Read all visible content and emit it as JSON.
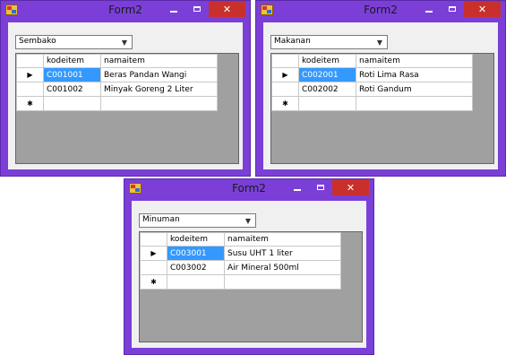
{
  "windows": [
    {
      "title": "Form2",
      "combo_value": "Sembako",
      "headers": [
        "kodeitem",
        "namaitem"
      ],
      "rows": [
        {
          "kode": "C001001",
          "nama": "Beras Pandan Wangi"
        },
        {
          "kode": "C001002",
          "nama": "Minyak Goreng 2 Liter"
        }
      ]
    },
    {
      "title": "Form2",
      "combo_value": "Makanan",
      "headers": [
        "kodeitem",
        "namaitem"
      ],
      "rows": [
        {
          "kode": "C002001",
          "nama": "Roti Lima Rasa"
        },
        {
          "kode": "C002002",
          "nama": "Roti Gandum"
        }
      ]
    },
    {
      "title": "Form2",
      "combo_value": "Minuman",
      "headers": [
        "kodeitem",
        "namaitem"
      ],
      "rows": [
        {
          "kode": "C003001",
          "nama": "Susu UHT 1 liter"
        },
        {
          "kode": "C003002",
          "nama": "Air Mineral 500ml"
        }
      ]
    }
  ],
  "glyphs": {
    "current_row": "▶",
    "new_row": "✱",
    "dropdown": "▼",
    "close": "✕"
  },
  "colors": {
    "frame": "#7b3fd8",
    "close_button": "#c9302c",
    "selection": "#3399ff",
    "grid_background": "#a0a0a0"
  }
}
